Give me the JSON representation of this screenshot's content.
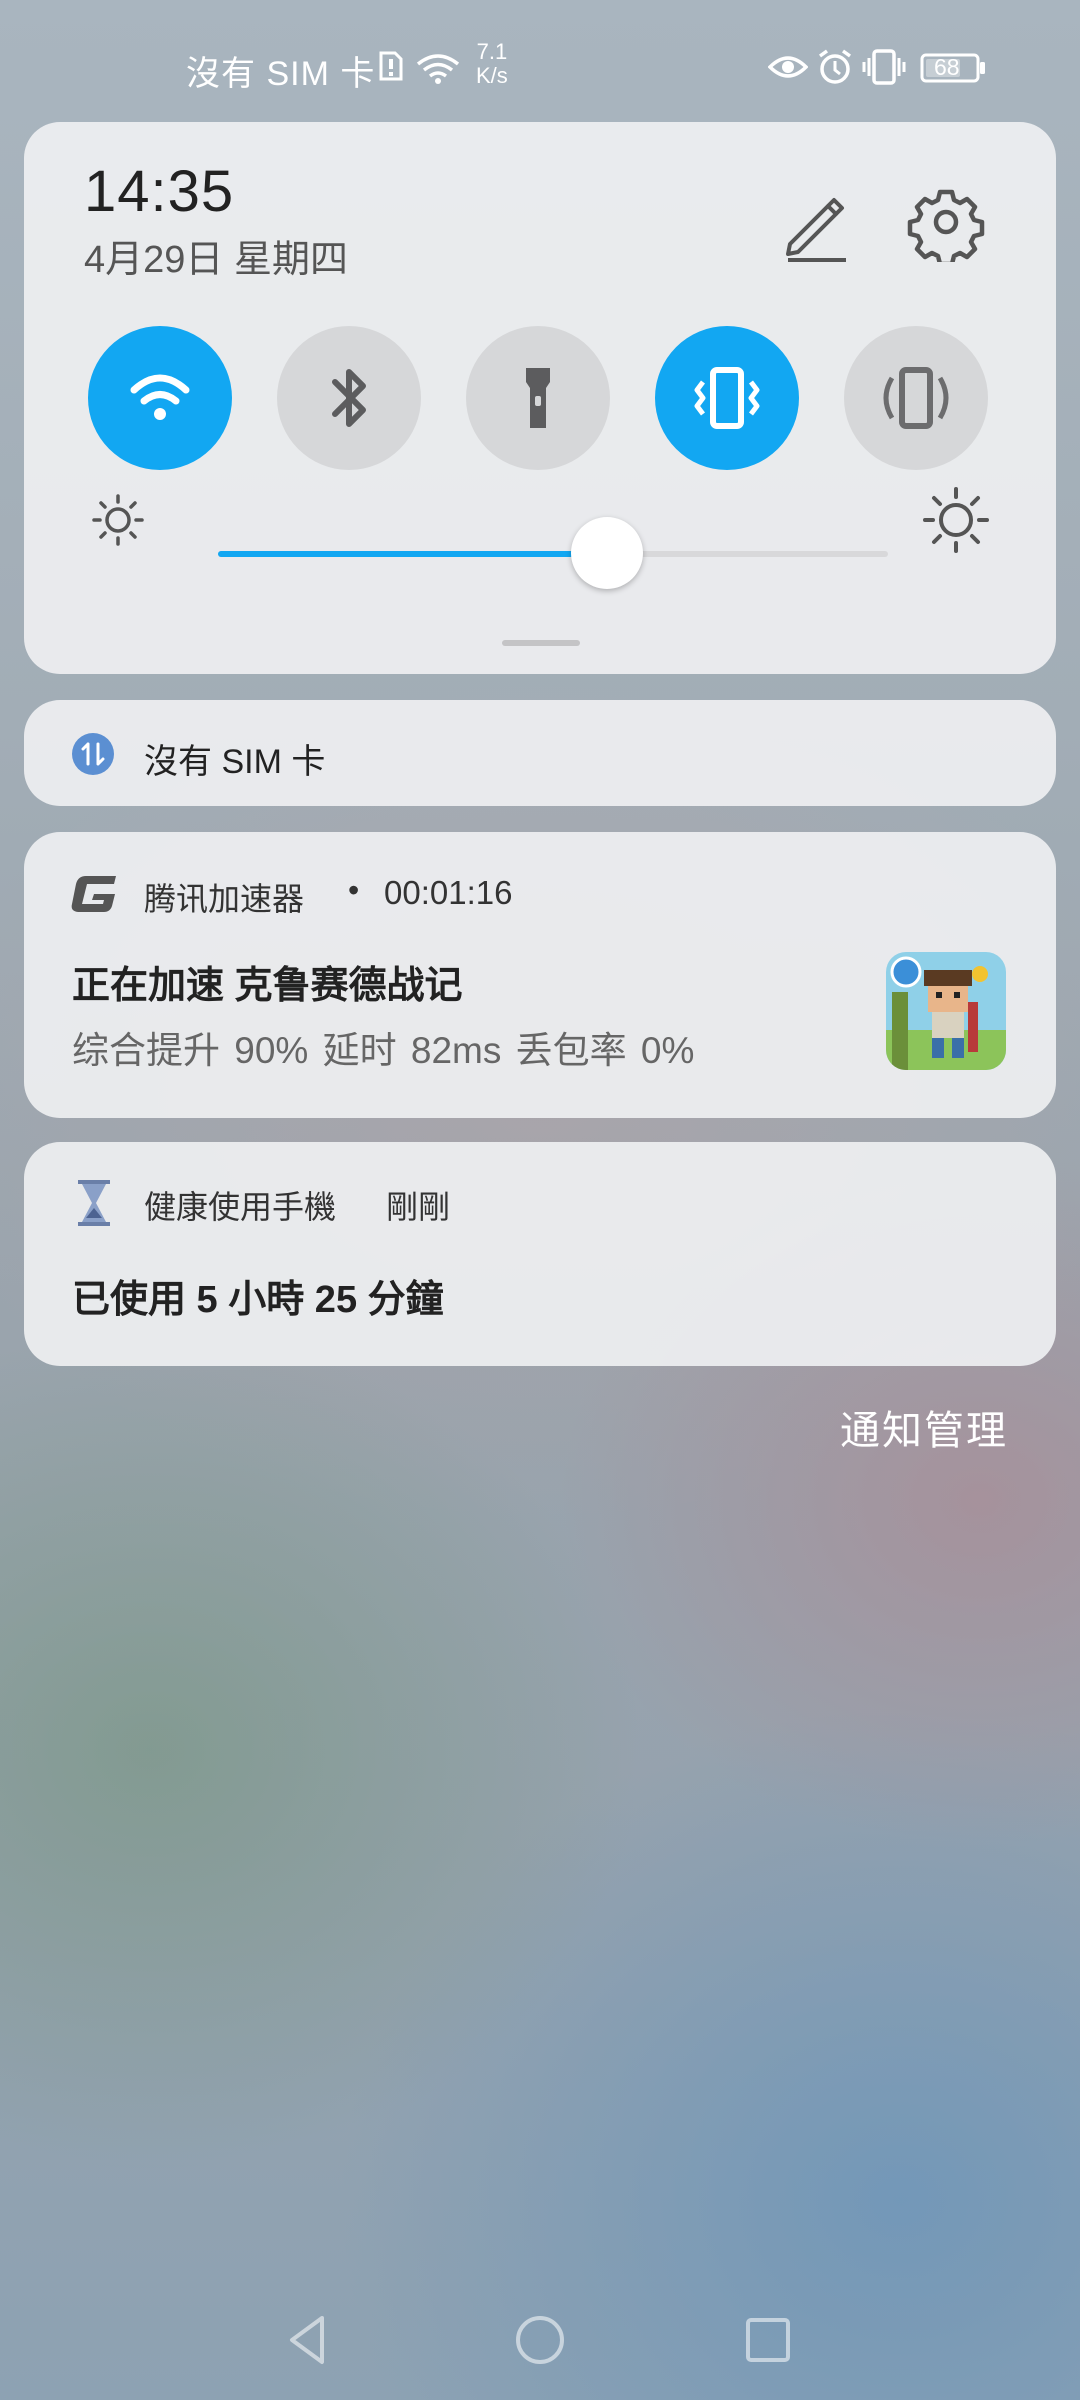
{
  "status_bar": {
    "carrier": "沒有 SIM 卡",
    "speed_value": "7.1",
    "speed_unit": "K/s",
    "battery": "68"
  },
  "quick_settings": {
    "time": "14:35",
    "date": "4月29日 星期四",
    "tiles": [
      {
        "name": "wifi",
        "active": true
      },
      {
        "name": "bluetooth",
        "active": false
      },
      {
        "name": "flashlight",
        "active": false
      },
      {
        "name": "vibrate",
        "active": true
      },
      {
        "name": "auto-rotate",
        "active": false
      }
    ],
    "brightness": 0.58,
    "accent_color": "#12a7f2"
  },
  "notifications": {
    "sim": {
      "text": "沒有 SIM 卡"
    },
    "accelerator": {
      "app": "腾讯加速器",
      "separator": "•",
      "time": "00:01:16",
      "title": "正在加速 克鲁赛德战记",
      "stats": "综合提升 90% 延时 82ms  丢包率 0%"
    },
    "health": {
      "app": "健康使用手機",
      "time": "剛剛",
      "message": "已使用 5 小時 25 分鐘"
    }
  },
  "manage_label": "通知管理"
}
